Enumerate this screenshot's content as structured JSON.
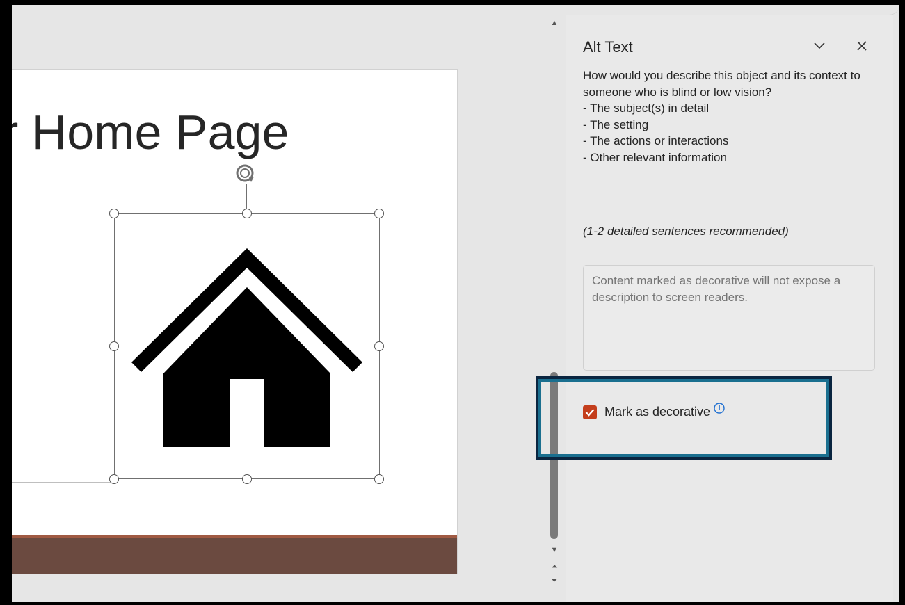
{
  "slide": {
    "title": "r Home Page"
  },
  "panel": {
    "title": "Alt Text",
    "collapse_icon": "chevron-down-icon",
    "close_icon": "close-icon",
    "description_lines": [
      "How would you describe this object and its context to someone who is blind or low vision?",
      "- The subject(s) in detail",
      "- The setting",
      "- The actions or interactions",
      "- Other relevant information"
    ],
    "recommendation": "(1-2 detailed sentences recommended)",
    "alt_text_placeholder": "Content marked as decorative will not expose a description to screen readers.",
    "decorative_label": "Mark as decorative",
    "decorative_checked": true,
    "info_icon": "info-icon"
  },
  "colors": {
    "checkbox": "#c43e1c",
    "highlight_border": "#0d7aa0",
    "footer_band": "#6b4a40",
    "footer_stripe": "#a05a43"
  }
}
